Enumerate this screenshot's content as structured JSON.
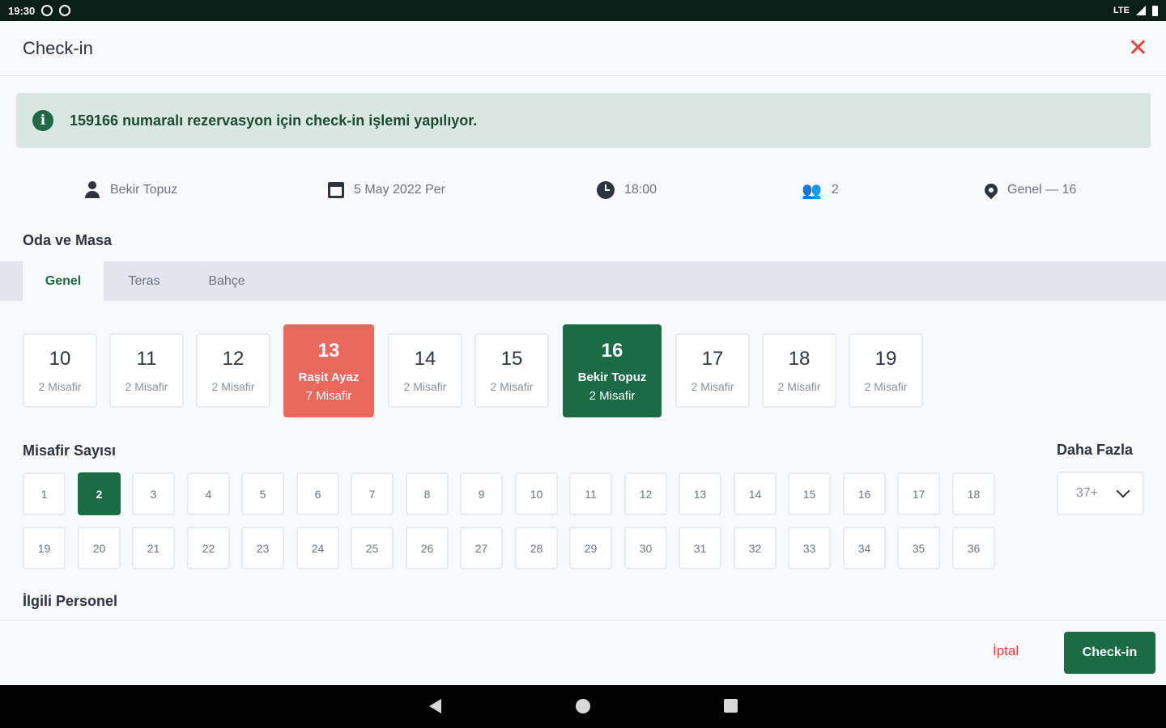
{
  "status_bar": {
    "time": "19:30",
    "network": "LTE"
  },
  "header": {
    "title": "Check-in"
  },
  "banner": {
    "text": "159166 numaralı rezervasyon için check-in işlemi yapılıyor."
  },
  "summary": {
    "guest_name": "Bekir Topuz",
    "date": "5 May 2022 Per",
    "time": "18:00",
    "guest_count": "2",
    "location": "Genel — 16"
  },
  "room_section": {
    "title": "Oda ve Masa"
  },
  "tabs": [
    {
      "label": "Genel",
      "active": true
    },
    {
      "label": "Teras",
      "active": false
    },
    {
      "label": "Bahçe",
      "active": false
    }
  ],
  "tables": [
    {
      "number": "10",
      "sub": "2 Misafir"
    },
    {
      "number": "11",
      "sub": "2 Misafir"
    },
    {
      "number": "12",
      "sub": "2 Misafir"
    },
    {
      "number": "13",
      "line1": "Raşit Ayaz",
      "line2": "7 Misafir",
      "state": "occupied"
    },
    {
      "number": "14",
      "sub": "2 Misafir"
    },
    {
      "number": "15",
      "sub": "2 Misafir"
    },
    {
      "number": "16",
      "line1": "Bekir Topuz",
      "line2": "2 Misafir",
      "state": "selected"
    },
    {
      "number": "17",
      "sub": "2 Misafir"
    },
    {
      "number": "18",
      "sub": "2 Misafir"
    },
    {
      "number": "19",
      "sub": "2 Misafir"
    }
  ],
  "guest_section": {
    "title": "Misafir Sayısı",
    "selected": "2"
  },
  "guest_numbers": [
    "1",
    "2",
    "3",
    "4",
    "5",
    "6",
    "7",
    "8",
    "9",
    "10",
    "11",
    "12",
    "13",
    "14",
    "15",
    "16",
    "17",
    "18",
    "19",
    "20",
    "21",
    "22",
    "23",
    "24",
    "25",
    "26",
    "27",
    "28",
    "29",
    "30",
    "31",
    "32",
    "33",
    "34",
    "35",
    "36"
  ],
  "more": {
    "title": "Daha Fazla",
    "value": "37+"
  },
  "staff_section": {
    "title": "İlgili Personel"
  },
  "footer": {
    "cancel_label": "İptal",
    "checkin_label": "Check-in"
  },
  "colors": {
    "accent_green": "#1b6b44",
    "occupied_red": "#e8685d",
    "close_red": "#e0453a"
  }
}
